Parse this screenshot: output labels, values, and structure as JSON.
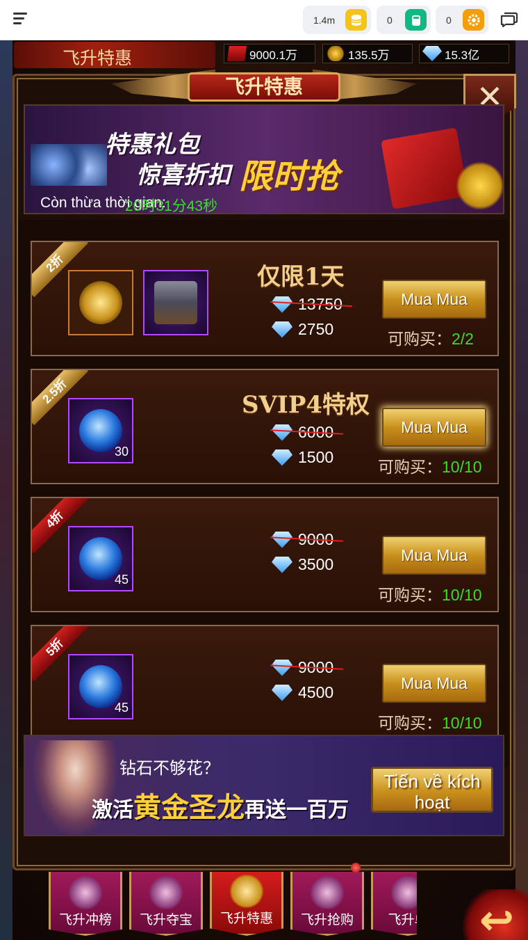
{
  "topbar": {
    "menu_icon": "hamburger-icon",
    "currencies": [
      {
        "value": "1.4m",
        "icon": "coin-stack-icon",
        "color": "#f5c419"
      },
      {
        "value": "0",
        "icon": "cylinder-icon",
        "color": "#10b981"
      },
      {
        "value": "0",
        "icon": "gear-coin-icon",
        "color": "#f59e0b"
      }
    ],
    "chat_icon": "chat-bubbles-icon"
  },
  "hud": {
    "title": "飞升特惠",
    "energy": "9000.1万",
    "gold": "135.5万",
    "diamonds": "15.3亿"
  },
  "panel": {
    "title": "飞升特惠",
    "close_label": "✕"
  },
  "promo": {
    "line1": "特惠礼包",
    "line2": "惊喜折扣",
    "line3": "限时抢",
    "countdown_label": "Còn thừa thời gian:",
    "countdown_value": "20时31分43秒"
  },
  "offers": [
    {
      "discount": "2折",
      "ribbon": "gold",
      "title": "仅限1天",
      "old_price": "13750",
      "new_price": "2750",
      "buy_label": "Mua Mua",
      "limit_label": "可购买：",
      "limit_value": "2/2",
      "items": [
        {
          "icon": "gold-medallion-icon",
          "qty": ""
        },
        {
          "icon": "treasure-chest-icon",
          "qty": ""
        }
      ]
    },
    {
      "discount": "2.5折",
      "ribbon": "gold",
      "title": "SVIP4特权",
      "old_price": "6000",
      "new_price": "1500",
      "buy_label": "Mua Mua",
      "limit_label": "可购买：",
      "limit_value": "10/10",
      "items": [
        {
          "icon": "blue-gem-icon",
          "qty": "30"
        }
      ]
    },
    {
      "discount": "4折",
      "ribbon": "red",
      "title": "",
      "old_price": "9000",
      "new_price": "3500",
      "buy_label": "Mua Mua",
      "limit_label": "可购买：",
      "limit_value": "10/10",
      "items": [
        {
          "icon": "blue-gem-icon",
          "qty": "45"
        }
      ]
    },
    {
      "discount": "5折",
      "ribbon": "red",
      "title": "",
      "old_price": "9000",
      "new_price": "4500",
      "buy_label": "Mua Mua",
      "limit_label": "可购买：",
      "limit_value": "10/10",
      "items": [
        {
          "icon": "blue-gem-icon",
          "qty": "45"
        }
      ]
    }
  ],
  "footer_ad": {
    "question": "钻石不够花？",
    "slogan_a": "激活",
    "slogan_hl": "黄金圣龙",
    "slogan_b": "再送一百万",
    "button_line1": "Tiến về kích",
    "button_line2": "hoạt"
  },
  "tabs": [
    {
      "label": "飞升冲榜",
      "icon": "trident-icon"
    },
    {
      "label": "飞升夺宝",
      "icon": "compass-icon"
    },
    {
      "label": "飞升特惠",
      "icon": "diamond-icon",
      "active": true
    },
    {
      "label": "飞升抢购",
      "icon": "money-bag-icon"
    },
    {
      "label": "飞升单",
      "icon": "gem-icon"
    }
  ],
  "back_icon": "back-arrow-icon"
}
